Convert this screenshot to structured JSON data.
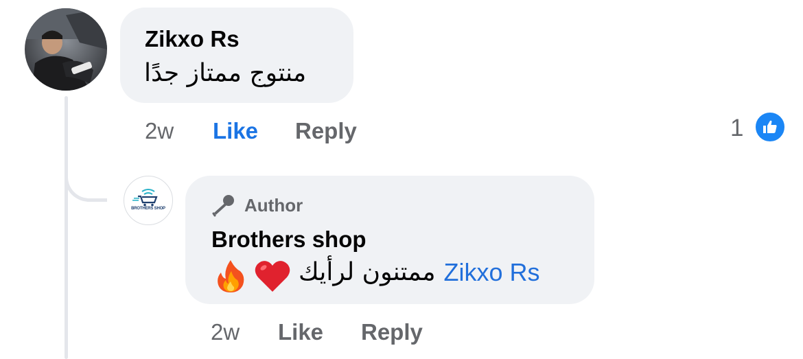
{
  "comment": {
    "author": "Zikxo Rs",
    "text": "منتوج ممتاز جدًا",
    "time": "2w",
    "like_label": "Like",
    "reply_label": "Reply",
    "reaction_count": "1",
    "reaction_icon": "thumbs-up-icon",
    "reaction_color": "#1b86f5"
  },
  "reply": {
    "badge_label": "Author",
    "badge_icon": "microphone-icon",
    "author": "Brothers shop",
    "avatar_text": "BROTHERS SHOP",
    "mention": "Zikxo Rs",
    "text": "ممتنون لرأيك",
    "emojis": [
      "heart",
      "fire"
    ],
    "time": "2w",
    "like_label": "Like",
    "reply_label": "Reply"
  },
  "colors": {
    "bubble": "#f0f2f5",
    "mention": "#216fdb",
    "active_like": "#1b74e4",
    "meta": "#65676b"
  }
}
